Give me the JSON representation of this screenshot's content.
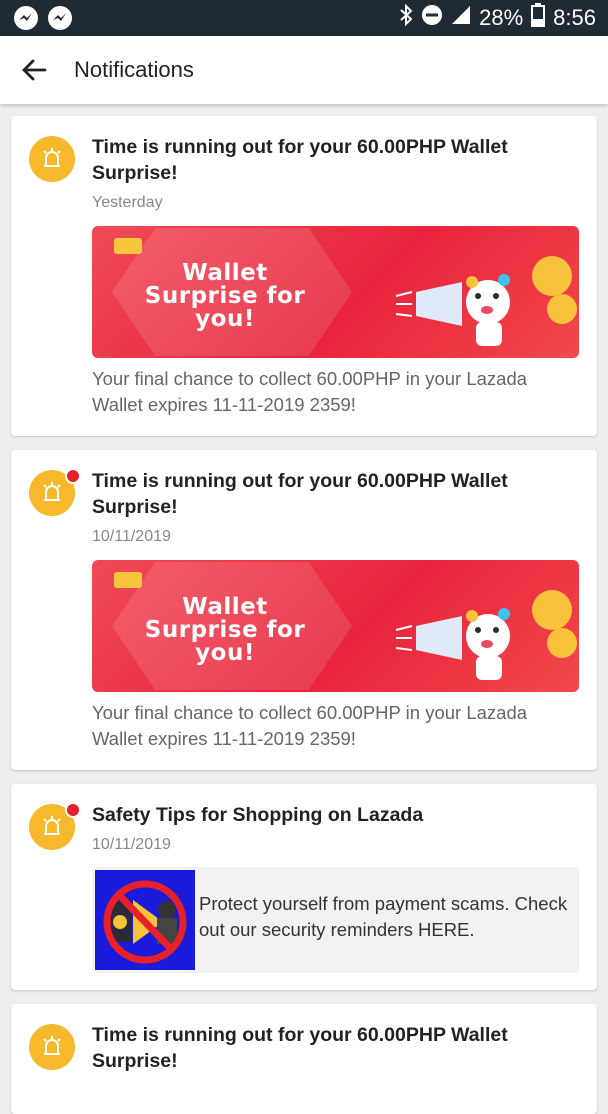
{
  "status_bar": {
    "battery": "28%",
    "time": "8:56"
  },
  "app_bar": {
    "title": "Notifications"
  },
  "notifications": [
    {
      "title": "Time is running out for your 60.00PHP Wallet Surprise!",
      "date": "Yesterday",
      "banner_text": "Wallet Surprise for you!",
      "body": "Your final chance to collect 60.00PHP in your Lazada Wallet expires 11-11-2019 2359!",
      "unread": false
    },
    {
      "title": "Time is running out for your 60.00PHP Wallet Surprise!",
      "date": "10/11/2019",
      "banner_text": "Wallet Surprise for you!",
      "body": "Your final chance to collect 60.00PHP in your Lazada Wallet expires 11-11-2019 2359!",
      "unread": true
    },
    {
      "title": "Safety Tips for Shopping on Lazada",
      "date": "10/11/2019",
      "body": "Protect yourself from payment scams. Check out our security reminders HERE.",
      "unread": true
    },
    {
      "title": "Time is running out for your 60.00PHP Wallet Surprise!",
      "unread": false
    }
  ],
  "colors": {
    "accent_icon": "#f6b92b",
    "unread_dot": "#e8202a",
    "banner": "#e8243c"
  }
}
